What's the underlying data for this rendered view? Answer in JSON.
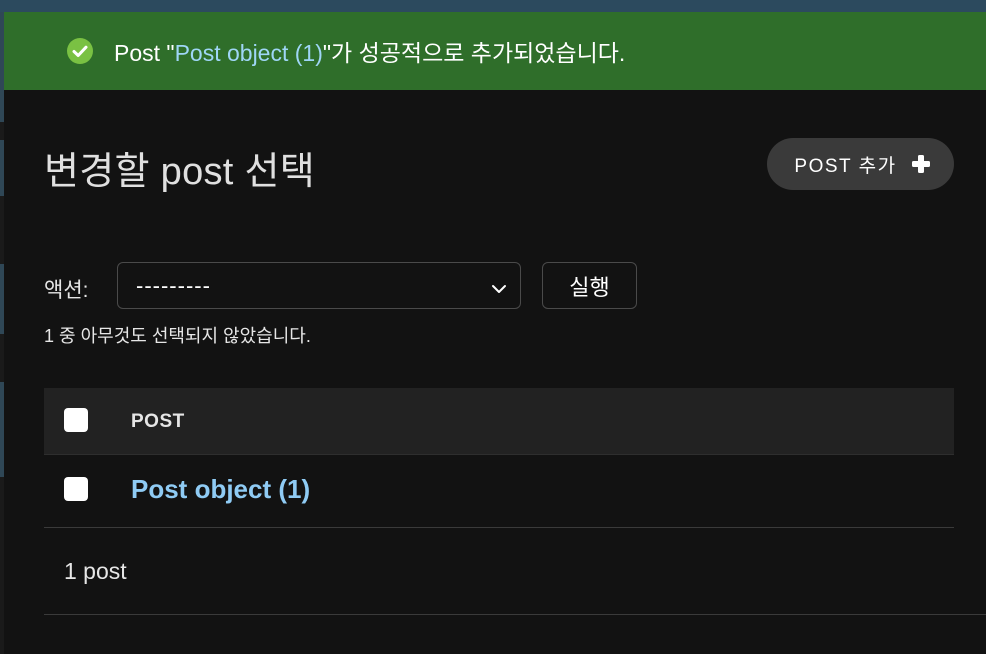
{
  "messages": {
    "success_prefix": "Post \"",
    "success_link": "Post object (1)",
    "success_suffix": "\"가 성공적으로 추가되었습니다.",
    "icon": "check-circle-icon",
    "color": "#2f6e2a"
  },
  "page": {
    "title": "변경할 post 선택",
    "add_button": "POST 추가",
    "add_icon": "plus-icon"
  },
  "actions": {
    "label": "액션:",
    "select_value": "---------",
    "go_button": "실행",
    "counter": "1 중 아무것도 선택되지 않았습니다."
  },
  "table": {
    "header": "POST",
    "rows": [
      {
        "label": "Post object (1)"
      }
    ]
  },
  "paginator": {
    "count": "1 post"
  },
  "colors": {
    "background": "#121212",
    "link": "#8fcbf4",
    "success_bar": "#2f6e2a"
  }
}
